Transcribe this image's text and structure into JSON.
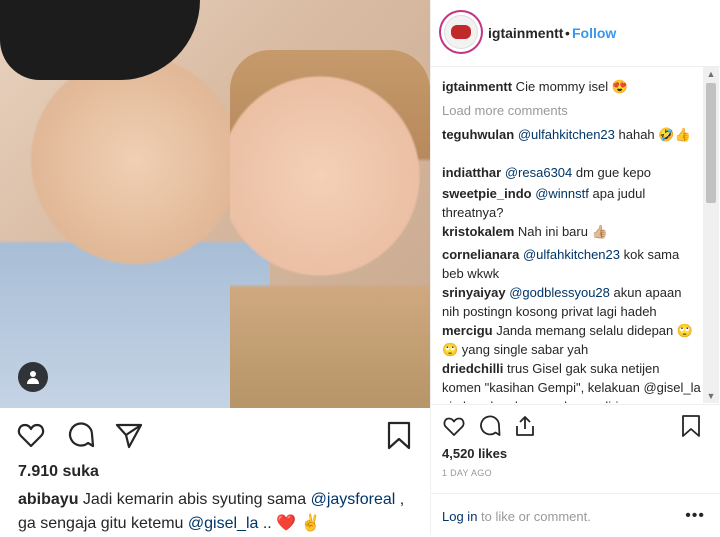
{
  "post": {
    "left": {
      "likes": "7.910 suka",
      "caption_user": "abibayu",
      "caption_text_1": " Jadi kemarin abis syuting sama ",
      "mention_1": "@jaysforeal",
      "caption_text_2": " , ga sengaja gitu ketemu ",
      "mention_2": "@gisel_la",
      "caption_text_3": " .. ",
      "emoji": "❤️ ✌️"
    },
    "right": {
      "username": "igtainmentt",
      "dot": "•",
      "follow_label": "Follow",
      "caption_user": "igtainmentt",
      "caption_text": " Cie mommy isel 😍",
      "load_more": "Load more comments",
      "comments": [
        {
          "user": "teguhwulan",
          "mention": "@ulfahkitchen23",
          "text": " hahah 🤣👍"
        },
        {
          "user": "indiatthar",
          "mention": "@resa6304",
          "text": " dm gue kepo"
        },
        {
          "user": "sweetpie_indo",
          "mention": "@winnstf",
          "text": " apa judul threatnya?"
        },
        {
          "user": "kristokalem",
          "mention": "",
          "text": " Nah ini baru 👍🏼"
        },
        {
          "user": "cornelianara",
          "mention": "@ulfahkitchen23",
          "text": " kok sama beb wkwk"
        },
        {
          "user": "srinyaiyay",
          "mention": "@godblessyou28",
          "text": " akun apaan nih postingn kosong privat lagi hadeh"
        },
        {
          "user": "mercigu",
          "mention": "",
          "text": " Janda memang selalu didepan 🙄🙄 yang single sabar yah"
        },
        {
          "user": "driedchilli",
          "mention": "",
          "text": " trus Gisel gak suka netijen komen \"kasihan Gempi\", kelakuan @gisel_la aja kayak gak punya harga diri"
        }
      ],
      "likes": "4,520 likes",
      "timestamp": "1 DAY AGO",
      "login_link": "Log in",
      "login_text": " to like or comment.",
      "more": "•••"
    }
  },
  "icons": [
    "heart-icon",
    "comment-icon",
    "share-icon",
    "bookmark-icon",
    "user-tag-icon"
  ]
}
